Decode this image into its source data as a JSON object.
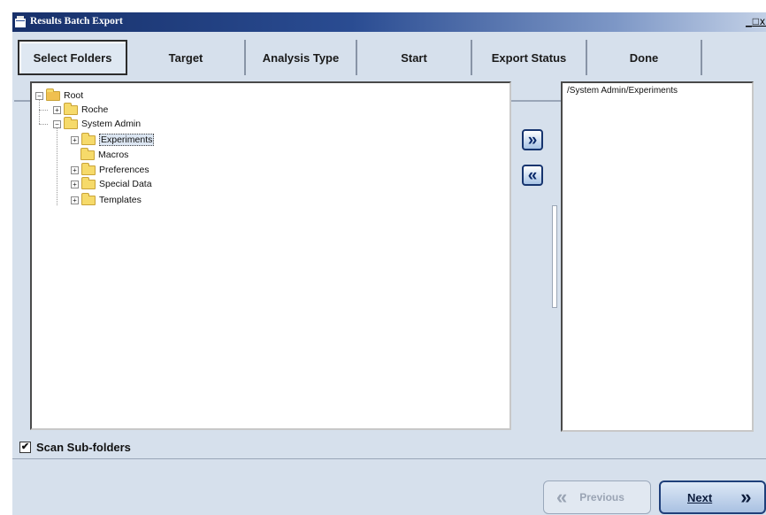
{
  "window": {
    "title": "Results Batch Export",
    "controls": {
      "minimize": "_",
      "maximize": "□",
      "close": "x"
    }
  },
  "tabs": [
    {
      "label": "Select Folders",
      "active": true
    },
    {
      "label": "Target",
      "active": false
    },
    {
      "label": "Analysis Type",
      "active": false
    },
    {
      "label": "Start",
      "active": false
    },
    {
      "label": "Export Status",
      "active": false
    },
    {
      "label": "Done",
      "active": false
    }
  ],
  "tree": {
    "root": {
      "label": "Root",
      "expander": "−"
    },
    "roche": {
      "label": "Roche",
      "expander": "+"
    },
    "system_admin": {
      "label": "System Admin",
      "expander": "−"
    },
    "experiments": {
      "label": "Experiments",
      "expander": "+",
      "selected": true
    },
    "macros": {
      "label": "Macros"
    },
    "preferences": {
      "label": "Preferences",
      "expander": "+"
    },
    "special_data": {
      "label": "Special Data",
      "expander": "+"
    },
    "templates": {
      "label": "Templates",
      "expander": "+"
    }
  },
  "move_buttons": {
    "add_glyph": "»",
    "remove_glyph": "«"
  },
  "target_list": {
    "items": [
      "/System Admin/Experiments"
    ]
  },
  "scan_subfolders": {
    "label": "Scan Sub-folders",
    "checked": true,
    "mark": "✔"
  },
  "nav": {
    "previous_label": "Previous",
    "previous_glyph": "«",
    "previous_enabled": false,
    "next_label": "Next",
    "next_glyph": "»"
  },
  "colors": {
    "titlebar": "#17306a",
    "background": "#d6e0ec",
    "accent": "#17356f"
  }
}
